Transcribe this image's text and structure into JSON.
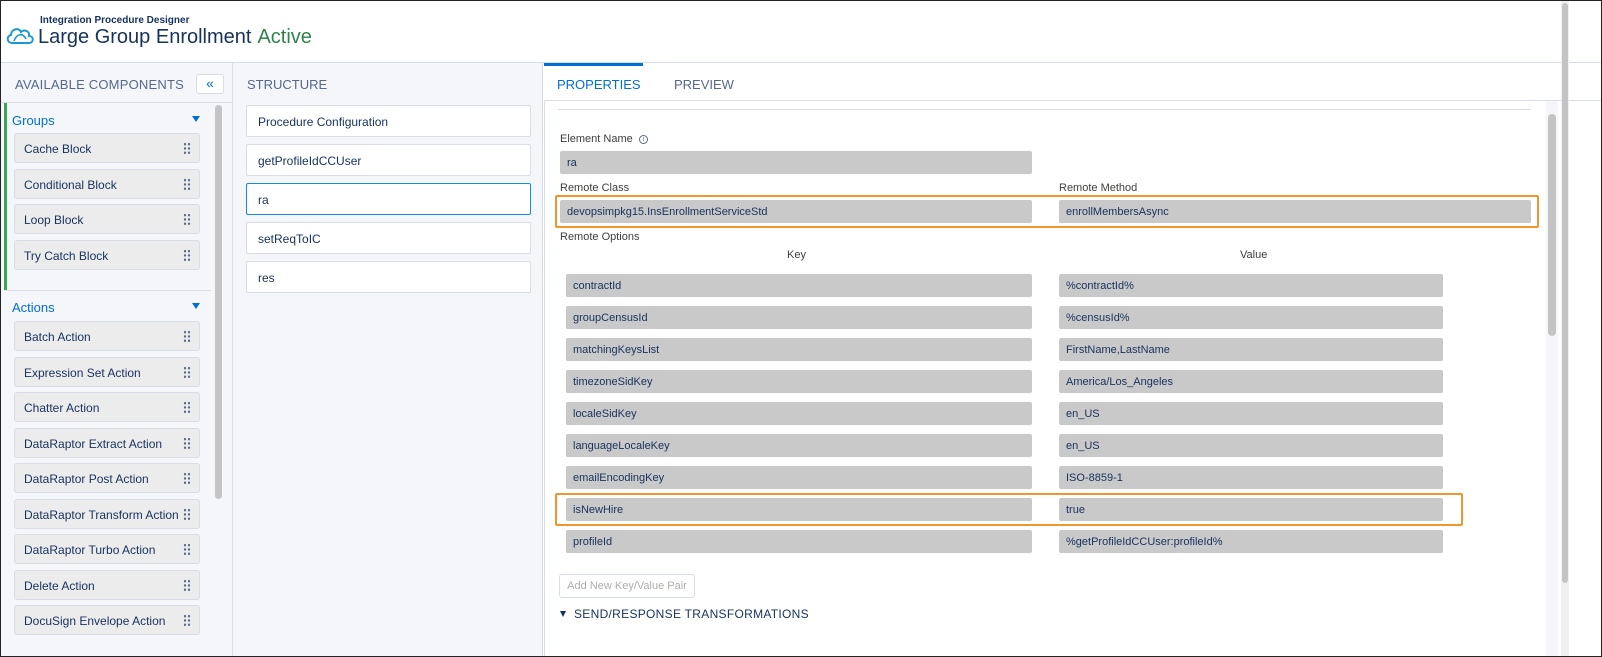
{
  "header": {
    "app_name": "Integration Procedure Designer",
    "procedure_name": "Large Group Enrollment",
    "status": "Active"
  },
  "components": {
    "title": "AVAILABLE COMPONENTS",
    "collapse_label": "«",
    "groups": [
      {
        "label": "Groups",
        "items": [
          "Cache Block",
          "Conditional Block",
          "Loop Block",
          "Try Catch Block"
        ]
      },
      {
        "label": "Actions",
        "items": [
          "Batch Action",
          "Expression Set Action",
          "Chatter Action",
          "DataRaptor Extract Action",
          "DataRaptor Post Action",
          "DataRaptor Transform Action",
          "DataRaptor Turbo Action",
          "Delete Action",
          "DocuSign Envelope Action"
        ]
      }
    ]
  },
  "structure": {
    "title": "STRUCTURE",
    "items": [
      "Procedure Configuration",
      "getProfileIdCCUser",
      "ra",
      "setReqToIC",
      "res"
    ],
    "selected_index": 2
  },
  "properties": {
    "tabs": [
      "PROPERTIES",
      "PREVIEW"
    ],
    "active_tab": 0,
    "element_name_label": "Element Name",
    "element_name_value": "ra",
    "remote_class_label": "Remote Class",
    "remote_class_value": "devopsimpkg15.InsEnrollmentServiceStd",
    "remote_method_label": "Remote Method",
    "remote_method_value": "enrollMembersAsync",
    "remote_options_label": "Remote Options",
    "key_header": "Key",
    "value_header": "Value",
    "options": [
      {
        "key": "contractId",
        "value": "%contractId%"
      },
      {
        "key": "groupCensusId",
        "value": "%censusId%"
      },
      {
        "key": "matchingKeysList",
        "value": "FirstName,LastName"
      },
      {
        "key": "timezoneSidKey",
        "value": "America/Los_Angeles"
      },
      {
        "key": "localeSidKey",
        "value": "en_US"
      },
      {
        "key": "languageLocaleKey",
        "value": "en_US"
      },
      {
        "key": "emailEncodingKey",
        "value": "ISO-8859-1"
      },
      {
        "key": "isNewHire",
        "value": "true"
      },
      {
        "key": "profileId",
        "value": "%getProfileIdCCUser:profileId%"
      }
    ],
    "add_pair_label": "Add New Key/Value Pair",
    "section_title": "SEND/RESPONSE TRANSFORMATIONS"
  },
  "colors": {
    "accent": "#0070d2",
    "status_active": "#2e844a",
    "highlight": "#f0962e",
    "group_accent": "#3ba755"
  }
}
